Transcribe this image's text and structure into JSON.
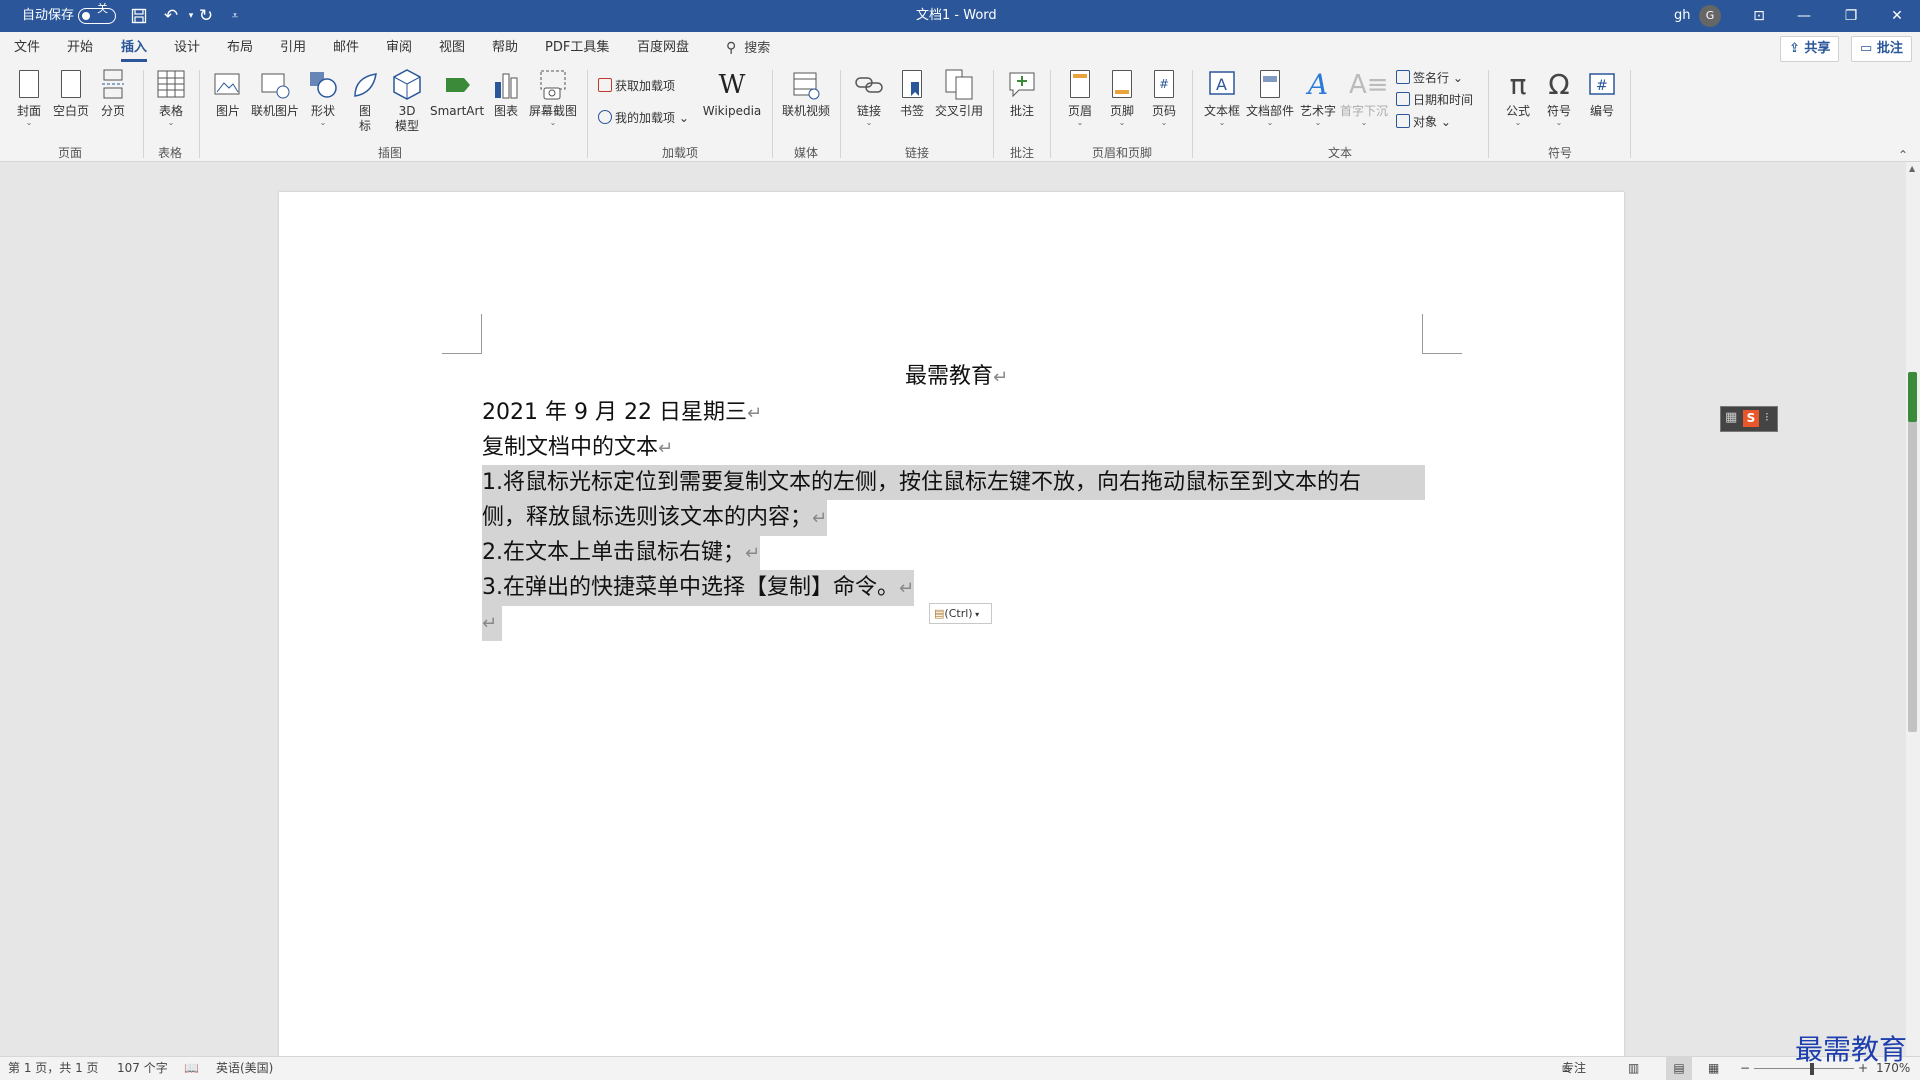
{
  "titlebar": {
    "autosave_label": "自动保存",
    "autosave_state": "关",
    "doc_title": "文档1 - Word",
    "user_initials": "gh",
    "avatar_letter": "G",
    "save_icon": "save-icon",
    "undo_icon": "undo-icon",
    "redo_icon": "redo-icon"
  },
  "menu": {
    "items": [
      "文件",
      "开始",
      "插入",
      "设计",
      "布局",
      "引用",
      "邮件",
      "审阅",
      "视图",
      "帮助",
      "PDF工具集",
      "百度网盘"
    ],
    "active": "插入",
    "search_label": "搜索",
    "share_label": "共享",
    "comment_label": "批注"
  },
  "ribbon": {
    "pages": {
      "cover": "封面",
      "blank_page": "空白页",
      "page_break": "分页",
      "group": "页面"
    },
    "tables": {
      "table": "表格",
      "group": "表格"
    },
    "illustrations": {
      "pictures": "图片",
      "online_pictures": "联机图片",
      "shapes": "形状",
      "icons_line1": "图",
      "icons_line2": "标",
      "model_line1": "3D",
      "model_line2": "模型",
      "smartart": "SmartArt",
      "chart": "图表",
      "screenshot": "屏幕截图",
      "group": "插图"
    },
    "addins": {
      "get_addins": "获取加载项",
      "my_addins": "我的加载项",
      "wikipedia": "Wikipedia",
      "group": "加载项"
    },
    "media": {
      "online_video": "联机视频",
      "group": "媒体"
    },
    "links": {
      "link": "链接",
      "bookmark": "书签",
      "cross_ref": "交叉引用",
      "group": "链接"
    },
    "comments": {
      "comment": "批注",
      "group": "批注"
    },
    "header_footer": {
      "header": "页眉",
      "footer": "页脚",
      "page_number": "页码",
      "group": "页眉和页脚"
    },
    "text": {
      "text_box": "文本框",
      "quick_parts": "文档部件",
      "wordart": "艺术字",
      "drop_cap": "首字下沉",
      "signature_line": "签名行",
      "date_time": "日期和时间",
      "object": "对象",
      "group": "文本"
    },
    "symbols": {
      "equation": "公式",
      "symbol": "符号",
      "number": "编号",
      "group": "符号"
    }
  },
  "document": {
    "title": "最需教育",
    "date_line": "2021 年 9 月 22 日星期三",
    "heading": "复制文档中的文本",
    "step1_line1": "1.将鼠标光标定位到需要复制文本的左侧，按住鼠标左键不放，向右拖动鼠标至到文本的右",
    "step1_line2": "侧，释放鼠标选则该文本的内容；",
    "step2": "2.在文本上单击鼠标右键；",
    "step3": "3.在弹出的快捷菜单中选择【复制】命令。",
    "paragraph_mark": "↵",
    "paste_options": "(Ctrl)"
  },
  "statusbar": {
    "page_info": "第 1 页，共 1 页",
    "word_count": "107 个字",
    "language": "英语(美国)",
    "focus": "专注",
    "zoom": "170%"
  },
  "watermark": "最需教育",
  "colors": {
    "accent": "#2b579a",
    "selection": "#d4d4d4"
  }
}
